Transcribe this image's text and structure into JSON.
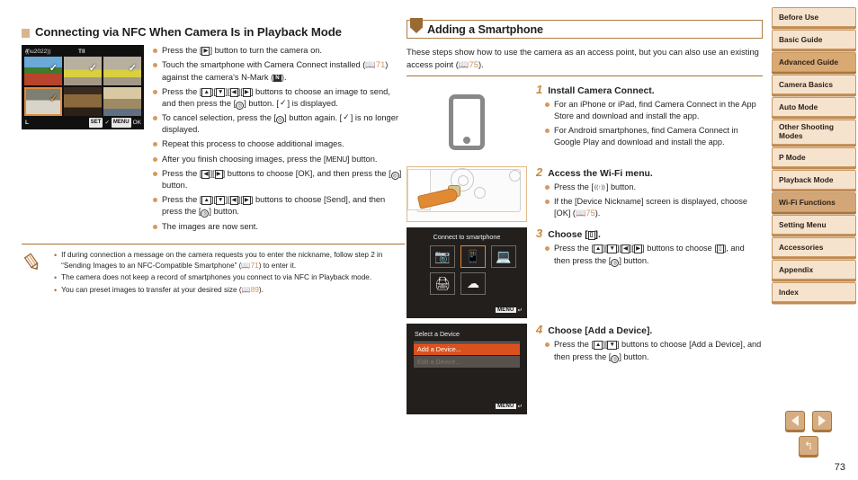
{
  "page": {
    "number": "73"
  },
  "left_column": {
    "heading": "Connecting via NFC When Camera Is in Playback Mode",
    "lcd_screen": {
      "wifi_label": "4",
      "signal_label": "Tll",
      "size_label": "L",
      "set_badge": "SET",
      "check_glyph": "✓",
      "menu_badge": "MENU",
      "ok_label": "OK"
    },
    "bullets": [
      "Press the [▶] button to turn the camera on.",
      "Touch the smartphone with Camera Connect installed ( 71) against the camera's N-Mark (N).",
      "Press the [▲][▼][◀][▶] buttons to choose an image to send, and then press the [Ⓐ] button. [✓] is displayed.",
      "To cancel selection, press the [Ⓐ] button again. [✓] is no longer displayed.",
      "Repeat this process to choose additional images.",
      "After you finish choosing images, press the [MENU] button.",
      "Press the [◀][▶] buttons to choose [OK], and then press the [Ⓐ] button.",
      "Press the [▲][▼][◀][▶] buttons to choose [Send], and then press the [Ⓐ] button.",
      "The images are now sent."
    ],
    "note_icon": "pencil-icon",
    "notes": [
      "If during connection a message on the camera requests you to enter the nickname, follow step 2 in “Sending Images to an NFC-Compatible Smartphone” ( 71) to enter it.",
      "The camera does not keep a record of smartphones you connect to via NFC in Playback mode.",
      "You can preset images to transfer at your desired size ( 89)."
    ],
    "note_refs": {
      "ref1": "71",
      "ref2": "89"
    }
  },
  "middle_column": {
    "heading": "Adding a Smartphone",
    "intro": "These steps show how to use the camera as an access point, but you can also use an existing access point ( 75).",
    "intro_ref": "75",
    "steps": [
      {
        "number": "1",
        "title": "Install Camera Connect.",
        "figure": "smartphone-icon",
        "bullets": [
          "For an iPhone or iPad, find Camera Connect in the App Store and download and install the app.",
          "For Android smartphones, find Camera Connect in Google Play and download and install the app."
        ]
      },
      {
        "number": "2",
        "title": "Access the Wi-Fi menu.",
        "figure": "camera-back-photo",
        "bullets": [
          "Press the [(↑)] button.",
          "If the [Device Nickname] screen is displayed, choose [OK] ( 75)."
        ]
      },
      {
        "number": "3",
        "title": "Choose [□].",
        "figure": "connect-to-smartphone-screen",
        "bullets": [
          "Press the [▲][▼][◀][▶] buttons to choose [□], and then press the [Ⓐ] button."
        ]
      },
      {
        "number": "4",
        "title": "Choose [Add a Device].",
        "figure": "select-a-device-screen",
        "bullets": [
          "Press the [▲][▼] buttons to choose [Add a Device], and then press the [Ⓐ] button."
        ]
      }
    ],
    "connect_screen": {
      "title": "Connect to smartphone",
      "icons": [
        "camera",
        "smartphone",
        "computer",
        "printer",
        "cloud"
      ],
      "selected_index": 1,
      "menu_badge": "MENU",
      "back_glyph": "↵"
    },
    "device_screen": {
      "title": "Select a Device",
      "rows": [
        {
          "label": "Add a Device...",
          "state": "selected"
        },
        {
          "label": "Edit a Device...",
          "state": "disabled"
        }
      ],
      "menu_badge": "MENU",
      "back_glyph": "↵"
    }
  },
  "sidebar": {
    "items": [
      {
        "label": "Before Use",
        "style": "normal"
      },
      {
        "label": "Basic Guide",
        "style": "normal"
      },
      {
        "label": "Advanced Guide",
        "style": "section"
      },
      {
        "label": "Camera Basics",
        "style": "normal"
      },
      {
        "label": "Auto Mode",
        "style": "normal"
      },
      {
        "label": "Other Shooting\nModes",
        "style": "normal-two"
      },
      {
        "label": "P Mode",
        "style": "normal"
      },
      {
        "label": "Playback Mode",
        "style": "normal"
      },
      {
        "label": "Wi-Fi Functions",
        "style": "current"
      },
      {
        "label": "Setting Menu",
        "style": "normal"
      },
      {
        "label": "Accessories",
        "style": "normal"
      },
      {
        "label": "Appendix",
        "style": "normal"
      },
      {
        "label": "Index",
        "style": "normal"
      }
    ]
  },
  "nav": {
    "prev_label": "previous-page",
    "next_label": "next-page",
    "back_label": "back",
    "back_glyph": "↰"
  },
  "colors": {
    "accent_orange": "#d49a5e",
    "heading_rule": "#a96f2d",
    "tab_bg": "#f6e3cd",
    "tab_current": "#d2a677",
    "tab_section": "#d8a972",
    "ref_link": "#c8965c"
  }
}
